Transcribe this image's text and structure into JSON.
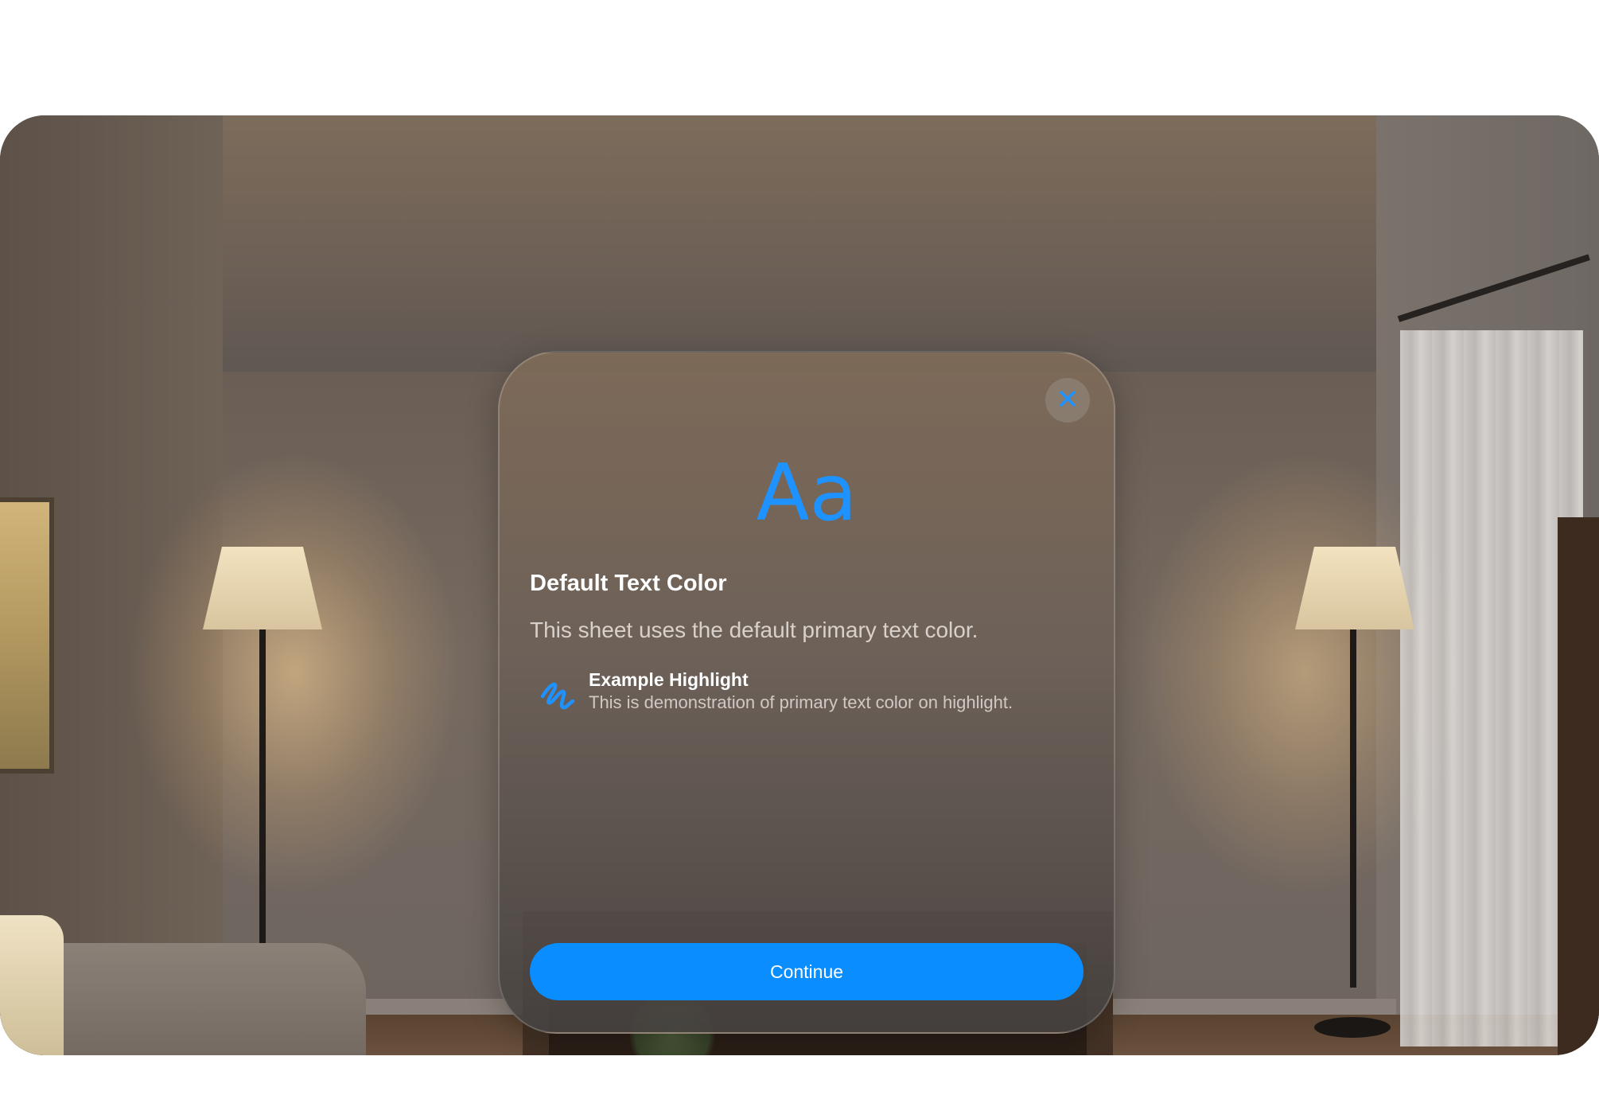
{
  "sheet": {
    "glyph": "Aa",
    "title": "Default Text Color",
    "body": "This sheet uses the default primary text color.",
    "highlight": {
      "icon": "scribble-icon",
      "title": "Example Highlight",
      "description": "This is demonstration of primary text color on highlight."
    },
    "continue_label": "Continue",
    "close_icon": "close-icon"
  },
  "colors": {
    "accent": "#0a8dff",
    "glyph": "#1e92ff",
    "title_text": "#ffffff"
  }
}
